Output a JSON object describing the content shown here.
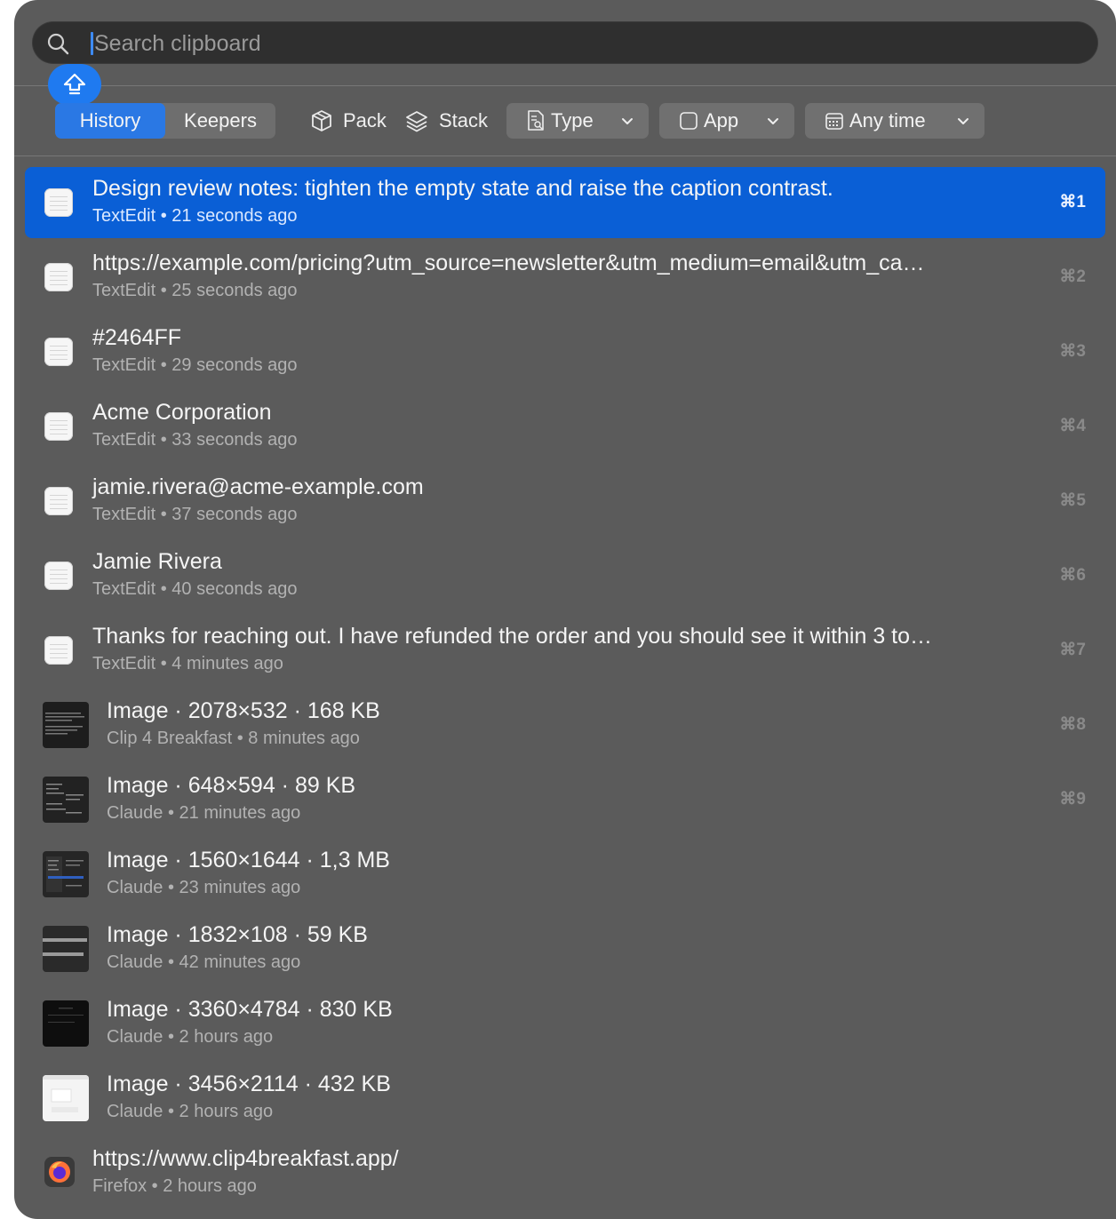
{
  "search": {
    "placeholder": "Search clipboard",
    "value": ""
  },
  "tabs": [
    {
      "label": "History",
      "active": true
    },
    {
      "label": "Keepers",
      "active": false
    }
  ],
  "toolbar": {
    "pack_label": "Pack",
    "stack_label": "Stack",
    "type_label": "Type",
    "app_label": "App",
    "time_label": "Any time"
  },
  "accent_color": "#0a5fd6",
  "items": [
    {
      "title": "Design review notes: tighten the empty state and raise the caption contrast.",
      "app": "TextEdit",
      "time": "21 seconds ago",
      "shortcut": "⌘1",
      "kind": "text"
    },
    {
      "title": "https://example.com/pricing?utm_source=newsletter&utm_medium=email&utm_ca…",
      "app": "TextEdit",
      "time": "25 seconds ago",
      "shortcut": "⌘2",
      "kind": "text"
    },
    {
      "title": "#2464FF",
      "app": "TextEdit",
      "time": "29 seconds ago",
      "shortcut": "⌘3",
      "kind": "text"
    },
    {
      "title": "Acme Corporation",
      "app": "TextEdit",
      "time": "33 seconds ago",
      "shortcut": "⌘4",
      "kind": "text"
    },
    {
      "title": "jamie.rivera@acme-example.com",
      "app": "TextEdit",
      "time": "37 seconds ago",
      "shortcut": "⌘5",
      "kind": "text"
    },
    {
      "title": "Jamie Rivera",
      "app": "TextEdit",
      "time": "40 seconds ago",
      "shortcut": "⌘6",
      "kind": "text"
    },
    {
      "title": "Thanks for reaching out. I have refunded the order and you should see it within 3 to…",
      "app": "TextEdit",
      "time": "4 minutes ago",
      "shortcut": "⌘7",
      "kind": "text"
    },
    {
      "title": "Image · 2078×532 · 168 KB",
      "app": "Clip 4 Breakfast",
      "time": "8 minutes ago",
      "shortcut": "⌘8",
      "kind": "image"
    },
    {
      "title": "Image · 648×594 · 89 KB",
      "app": "Claude",
      "time": "21 minutes ago",
      "shortcut": "⌘9",
      "kind": "image"
    },
    {
      "title": "Image · 1560×1644 · 1,3 MB",
      "app": "Claude",
      "time": "23 minutes ago",
      "shortcut": "",
      "kind": "image"
    },
    {
      "title": "Image · 1832×108 · 59 KB",
      "app": "Claude",
      "time": "42 minutes ago",
      "shortcut": "",
      "kind": "image"
    },
    {
      "title": "Image · 3360×4784 · 830 KB",
      "app": "Claude",
      "time": "2 hours ago",
      "shortcut": "",
      "kind": "image"
    },
    {
      "title": "Image · 3456×2114 · 432 KB",
      "app": "Claude",
      "time": "2 hours ago",
      "shortcut": "",
      "kind": "image"
    },
    {
      "title": "https://www.clip4breakfast.app/",
      "app": "Firefox",
      "time": "2 hours ago",
      "shortcut": "",
      "kind": "link"
    }
  ]
}
